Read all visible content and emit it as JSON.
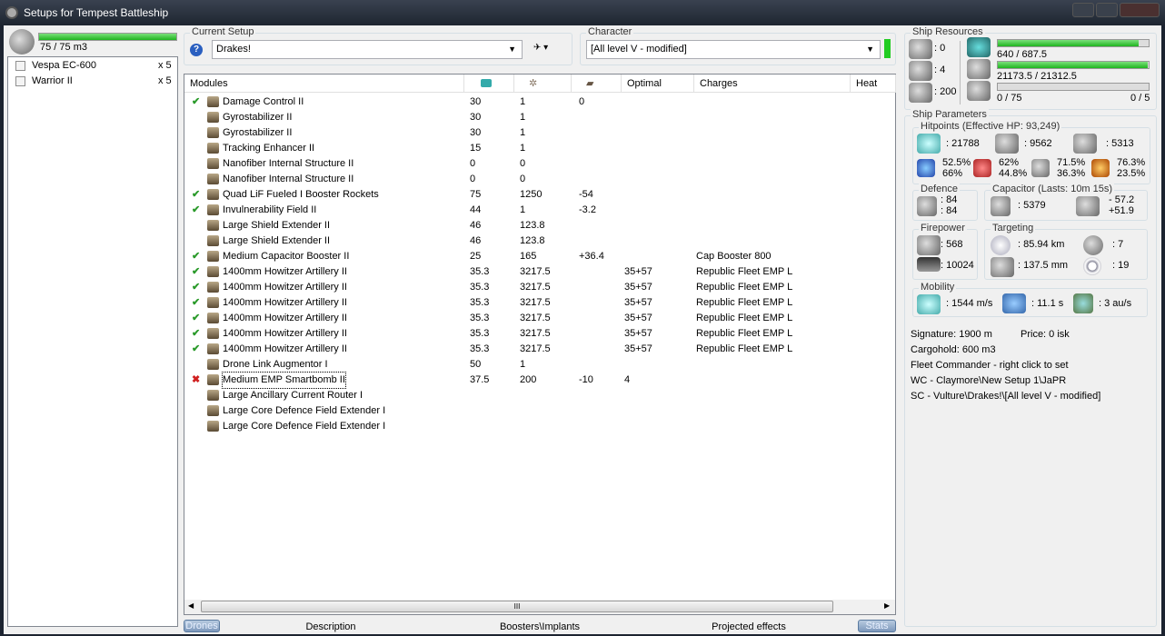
{
  "window": {
    "title": "Setups for Tempest Battleship"
  },
  "drones": {
    "bandwidth": "75 / 75 m3",
    "bandwidth_fill": 1.0,
    "items": [
      {
        "name": "Vespa EC-600",
        "count": "x 5"
      },
      {
        "name": "Warrior II",
        "count": "x 5"
      }
    ]
  },
  "setup": {
    "label": "Current Setup",
    "value": "Drakes!"
  },
  "character": {
    "label": "Character",
    "value": "[All level V - modified]",
    "status_color": "#22cc22"
  },
  "table": {
    "headers": [
      "Modules",
      "",
      "",
      "",
      "Optimal",
      "Charges",
      "Heat"
    ],
    "rows": [
      {
        "state": "ok",
        "name": "Damage Control II",
        "c1": "30",
        "c2": "1",
        "c3": "0",
        "opt": "",
        "charge": ""
      },
      {
        "state": "",
        "name": "Gyrostabilizer II",
        "c1": "30",
        "c2": "1",
        "c3": "",
        "opt": "",
        "charge": ""
      },
      {
        "state": "",
        "name": "Gyrostabilizer II",
        "c1": "30",
        "c2": "1",
        "c3": "",
        "opt": "",
        "charge": ""
      },
      {
        "state": "",
        "name": "Tracking Enhancer II",
        "c1": "15",
        "c2": "1",
        "c3": "",
        "opt": "",
        "charge": ""
      },
      {
        "state": "",
        "name": "Nanofiber Internal Structure II",
        "c1": "0",
        "c2": "0",
        "c3": "",
        "opt": "",
        "charge": ""
      },
      {
        "state": "",
        "name": "Nanofiber Internal Structure II",
        "c1": "0",
        "c2": "0",
        "c3": "",
        "opt": "",
        "charge": ""
      },
      {
        "state": "ok",
        "name": "Quad LiF Fueled I Booster Rockets",
        "c1": "75",
        "c2": "1250",
        "c3": "-54",
        "opt": "",
        "charge": ""
      },
      {
        "state": "ok",
        "name": "Invulnerability Field II",
        "c1": "44",
        "c2": "1",
        "c3": "-3.2",
        "opt": "",
        "charge": ""
      },
      {
        "state": "",
        "name": "Large Shield Extender II",
        "c1": "46",
        "c2": "123.8",
        "c3": "",
        "opt": "",
        "charge": ""
      },
      {
        "state": "",
        "name": "Large Shield Extender II",
        "c1": "46",
        "c2": "123.8",
        "c3": "",
        "opt": "",
        "charge": ""
      },
      {
        "state": "ok",
        "name": "Medium Capacitor Booster II",
        "c1": "25",
        "c2": "165",
        "c3": "+36.4",
        "opt": "",
        "charge": "Cap Booster 800"
      },
      {
        "state": "ok",
        "name": "1400mm Howitzer Artillery II",
        "c1": "35.3",
        "c2": "3217.5",
        "c3": "",
        "opt": "35+57",
        "charge": "Republic Fleet EMP L"
      },
      {
        "state": "ok",
        "name": "1400mm Howitzer Artillery II",
        "c1": "35.3",
        "c2": "3217.5",
        "c3": "",
        "opt": "35+57",
        "charge": "Republic Fleet EMP L"
      },
      {
        "state": "ok",
        "name": "1400mm Howitzer Artillery II",
        "c1": "35.3",
        "c2": "3217.5",
        "c3": "",
        "opt": "35+57",
        "charge": "Republic Fleet EMP L"
      },
      {
        "state": "ok",
        "name": "1400mm Howitzer Artillery II",
        "c1": "35.3",
        "c2": "3217.5",
        "c3": "",
        "opt": "35+57",
        "charge": "Republic Fleet EMP L"
      },
      {
        "state": "ok",
        "name": "1400mm Howitzer Artillery II",
        "c1": "35.3",
        "c2": "3217.5",
        "c3": "",
        "opt": "35+57",
        "charge": "Republic Fleet EMP L"
      },
      {
        "state": "ok",
        "name": "1400mm Howitzer Artillery II",
        "c1": "35.3",
        "c2": "3217.5",
        "c3": "",
        "opt": "35+57",
        "charge": "Republic Fleet EMP L"
      },
      {
        "state": "",
        "name": "Drone Link Augmentor I",
        "c1": "50",
        "c2": "1",
        "c3": "",
        "opt": "",
        "charge": ""
      },
      {
        "state": "off",
        "name": "Medium EMP Smartbomb II",
        "c1": "37.5",
        "c2": "200",
        "c3": "-10",
        "opt": "4",
        "charge": ""
      },
      {
        "state": "",
        "name": "Large Ancillary Current Router I",
        "c1": "",
        "c2": "",
        "c3": "",
        "opt": "",
        "charge": ""
      },
      {
        "state": "",
        "name": "Large Core Defence Field Extender I",
        "c1": "",
        "c2": "",
        "c3": "",
        "opt": "",
        "charge": ""
      },
      {
        "state": "",
        "name": "Large Core Defence Field Extender I",
        "c1": "",
        "c2": "",
        "c3": "",
        "opt": "",
        "charge": ""
      }
    ]
  },
  "resources": {
    "label": "Ship Resources",
    "turrets": ": 0",
    "launchers": ": 4",
    "drone_bay": ": 200",
    "cpu": "640 / 687.5",
    "cpu_fill": 0.931,
    "power": "21173.5 / 21312.5",
    "power_fill": 0.993,
    "calibration": "0 / 75",
    "rigs": "0 / 5",
    "calibration_fill": 0
  },
  "params": {
    "label": "Ship Parameters",
    "hp": {
      "label": "Hitpoints (Effective HP: 93,249)",
      "shield": ": 21788",
      "armor": ": 9562",
      "structure": ": 5313",
      "em": [
        "52.5%",
        "66%"
      ],
      "thermal": [
        "62%",
        "44.8%"
      ],
      "kinetic": [
        "71.5%",
        "36.3%"
      ],
      "explosive": [
        "76.3%",
        "23.5%"
      ]
    },
    "defence": {
      "label": "Defence",
      "a": ": 84",
      "b": ": 84"
    },
    "capacitor": {
      "label": "Capacitor (Lasts: 10m 15s)",
      "amount": ": 5379",
      "delta1": "- 57.2",
      "delta2": "+51.9"
    },
    "firepower": {
      "label": "Firepower",
      "dps": ": 568",
      "volley": ": 10024"
    },
    "targeting": {
      "label": "Targeting",
      "range": ": 85.94 km",
      "scan": ": 137.5 mm",
      "targets": ": 7",
      "sensor": ": 19"
    },
    "mobility": {
      "label": "Mobility",
      "speed": ": 1544 m/s",
      "align": ": 11.1 s",
      "warp": ": 3 au/s"
    }
  },
  "info": {
    "signature": "Signature: 1900 m",
    "price": "Price: 0 isk",
    "cargo": "Cargohold: 600 m3",
    "fleet": "Fleet Commander - right click to set",
    "wc": "WC - Claymore\\New Setup 1\\JaPR",
    "sc": "SC - Vulture\\Drakes!\\[All level V - modified]"
  },
  "tabs": {
    "drones": "Drones",
    "description": "Description",
    "boosters": "Boosters\\Implants",
    "projected": "Projected effects",
    "stats": "Stats"
  }
}
